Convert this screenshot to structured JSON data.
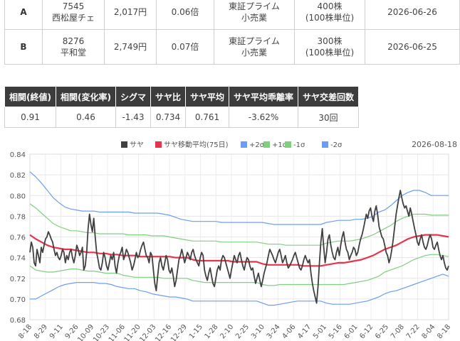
{
  "stocks": [
    {
      "label": "A",
      "code": "7545",
      "name": "西松屋チェ",
      "price": "2,017円",
      "pbr": "0.06倍",
      "market": "東証プライム",
      "sector": "小売業",
      "shares": "400株",
      "unit": "(100株単位)",
      "date": "2026-06-26"
    },
    {
      "label": "B",
      "code": "8276",
      "name": "平和堂",
      "price": "2,749円",
      "pbr": "0.07倍",
      "market": "東証プライム",
      "sector": "小売業",
      "shares": "300株",
      "unit": "(100株単位)",
      "date": "2026-06-25"
    }
  ],
  "stats": {
    "headers": [
      "相関(終値)",
      "相関(変化率)",
      "シグマ",
      "サヤ比",
      "サヤ平均",
      "サヤ平均乖離率",
      "サヤ交差回数"
    ],
    "values": [
      "0.91",
      "0.46",
      "-1.43",
      "0.734",
      "0.761",
      "-3.62%",
      "30回"
    ]
  },
  "chart_data": {
    "type": "line",
    "date_label": "2026-08-18",
    "legend": [
      {
        "name": "サヤ",
        "color": "#404040"
      },
      {
        "name": "サヤ移動平均(75日)",
        "color": "#e8334a"
      },
      {
        "name": "+2σ",
        "color": "#6b9df7"
      },
      {
        "name": "+1σ",
        "color": "#7fcf7f"
      },
      {
        "name": "-1σ",
        "color": "#7fcf7f"
      },
      {
        "name": "-2σ",
        "color": "#6b9df7"
      }
    ],
    "ylim": [
      0.68,
      0.84
    ],
    "yticks": [
      "0.84",
      "0.82",
      "0.80",
      "0.78",
      "0.76",
      "0.74",
      "0.72",
      "0.70",
      "0.68"
    ],
    "xticks": [
      "8-18",
      "8-29",
      "9-11",
      "9-26",
      "10-09",
      "10-23",
      "11-06",
      "11-20",
      "12-03",
      "12-16",
      "12-29",
      "1-15",
      "1-28",
      "2-10",
      "2-25",
      "3-10",
      "3-24",
      "4-06",
      "4-17",
      "5-01",
      "5-16",
      "6-01",
      "6-12",
      "6-25",
      "7-08",
      "7-22",
      "8-04",
      "8-18"
    ],
    "series": [
      {
        "name": "サヤ",
        "color": "#404040",
        "values": [
          0.745,
          0.755,
          0.75,
          0.735,
          0.732,
          0.748,
          0.742,
          0.735,
          0.75,
          0.745,
          0.752,
          0.758,
          0.76,
          0.765,
          0.762,
          0.758,
          0.755,
          0.748,
          0.742,
          0.745,
          0.74,
          0.738,
          0.742,
          0.748,
          0.745,
          0.735,
          0.742,
          0.738,
          0.745,
          0.748,
          0.74,
          0.735,
          0.742,
          0.752,
          0.748,
          0.742,
          0.745,
          0.75,
          0.728,
          0.732,
          0.745,
          0.768,
          0.782,
          0.772,
          0.765,
          0.778,
          0.76,
          0.745,
          0.738,
          0.73,
          0.728,
          0.735,
          0.745,
          0.74,
          0.732,
          0.728,
          0.735,
          0.742,
          0.738,
          0.745,
          0.732,
          0.725,
          0.735,
          0.742,
          0.745,
          0.75,
          0.738,
          0.742,
          0.748,
          0.745,
          0.74,
          0.735,
          0.728,
          0.732,
          0.738,
          0.745,
          0.74,
          0.742,
          0.748,
          0.752,
          0.755,
          0.748,
          0.742,
          0.74,
          0.735,
          0.745,
          0.742,
          0.728,
          0.715,
          0.708,
          0.722,
          0.735,
          0.74,
          0.732,
          0.728,
          0.735,
          0.742,
          0.738,
          0.728,
          0.725,
          0.73,
          0.722,
          0.712,
          0.718,
          0.728,
          0.738,
          0.742,
          0.748,
          0.742,
          0.735,
          0.74,
          0.745,
          0.742,
          0.738,
          0.745,
          0.748,
          0.742,
          0.738,
          0.735,
          0.732,
          0.74,
          0.745,
          0.742,
          0.728,
          0.722,
          0.718,
          0.725,
          0.73,
          0.722,
          0.715,
          0.712,
          0.72,
          0.728,
          0.732,
          0.728,
          0.738,
          0.742,
          0.74,
          0.735,
          0.73,
          0.725,
          0.72,
          0.728,
          0.735,
          0.742,
          0.738,
          0.735,
          0.742,
          0.745,
          0.738,
          0.732,
          0.728,
          0.735,
          0.74,
          0.738,
          0.732,
          0.728,
          0.73,
          0.722,
          0.715,
          0.72,
          0.725,
          0.718,
          0.712,
          0.718,
          0.725,
          0.73,
          0.735,
          0.742,
          0.748,
          0.745,
          0.742,
          0.738,
          0.735,
          0.74,
          0.745,
          0.748,
          0.742,
          0.735,
          0.738,
          0.742,
          0.735,
          0.73,
          0.732,
          0.735,
          0.738,
          0.742,
          0.745,
          0.74,
          0.735,
          0.73,
          0.728,
          0.732,
          0.738,
          0.742,
          0.738,
          0.735,
          0.738,
          0.725,
          0.715,
          0.708,
          0.702,
          0.696,
          0.712,
          0.735,
          0.755,
          0.768,
          0.75,
          0.735,
          0.745,
          0.758,
          0.762,
          0.752,
          0.745,
          0.74,
          0.738,
          0.745,
          0.75,
          0.742,
          0.752,
          0.76,
          0.765,
          0.755,
          0.748,
          0.745,
          0.738,
          0.742,
          0.745,
          0.75,
          0.748,
          0.742,
          0.745,
          0.752,
          0.758,
          0.762,
          0.768,
          0.775,
          0.782,
          0.778,
          0.785,
          0.788,
          0.78,
          0.775,
          0.785,
          0.79,
          0.782,
          0.77,
          0.765,
          0.76,
          0.758,
          0.752,
          0.745,
          0.742,
          0.735,
          0.74,
          0.748,
          0.758,
          0.77,
          0.782,
          0.79,
          0.798,
          0.805,
          0.798,
          0.792,
          0.788,
          0.79,
          0.785,
          0.78,
          0.788,
          0.782,
          0.775,
          0.768,
          0.762,
          0.755,
          0.752,
          0.758,
          0.762,
          0.755,
          0.75,
          0.748,
          0.752,
          0.758,
          0.762,
          0.758,
          0.75,
          0.748,
          0.752,
          0.755,
          0.748,
          0.742,
          0.738,
          0.742,
          0.735,
          0.73,
          0.728,
          0.732
        ]
      },
      {
        "name": "サヤ移動平均(75日)",
        "color": "#e8334a",
        "values": [
          0.762,
          0.758,
          0.755,
          0.752,
          0.75,
          0.749,
          0.748,
          0.748,
          0.747,
          0.746,
          0.745,
          0.745,
          0.744,
          0.744,
          0.743,
          0.743,
          0.742,
          0.742,
          0.742,
          0.741,
          0.741,
          0.741,
          0.741,
          0.741,
          0.741,
          0.74,
          0.74,
          0.74,
          0.738,
          0.737,
          0.737,
          0.737,
          0.737,
          0.737,
          0.737,
          0.736,
          0.736,
          0.736,
          0.736,
          0.736,
          0.734,
          0.733,
          0.733,
          0.733,
          0.733,
          0.733,
          0.733,
          0.732,
          0.732,
          0.732,
          0.732,
          0.733,
          0.734,
          0.735,
          0.735,
          0.736,
          0.737,
          0.738,
          0.74,
          0.742,
          0.745,
          0.748,
          0.75,
          0.752,
          0.755,
          0.758,
          0.76,
          0.761,
          0.762,
          0.762,
          0.762,
          0.761,
          0.76
        ]
      },
      {
        "name": "+2σ",
        "color": "#6b9df7",
        "values": [
          0.823,
          0.818,
          0.812,
          0.805,
          0.798,
          0.793,
          0.789,
          0.787,
          0.786,
          0.785,
          0.785,
          0.785,
          0.784,
          0.784,
          0.784,
          0.784,
          0.784,
          0.784,
          0.783,
          0.783,
          0.783,
          0.783,
          0.783,
          0.782,
          0.781,
          0.779,
          0.777,
          0.776,
          0.775,
          0.775,
          0.775,
          0.775,
          0.775,
          0.774,
          0.774,
          0.774,
          0.774,
          0.774,
          0.774,
          0.774,
          0.774,
          0.773,
          0.772,
          0.772,
          0.772,
          0.772,
          0.772,
          0.772,
          0.772,
          0.772,
          0.772,
          0.774,
          0.775,
          0.776,
          0.776,
          0.776,
          0.777,
          0.777,
          0.778,
          0.78,
          0.784,
          0.786,
          0.79,
          0.795,
          0.8,
          0.803,
          0.805,
          0.805,
          0.803,
          0.8,
          0.8,
          0.8,
          0.8
        ]
      },
      {
        "name": "+1σ",
        "color": "#7fcf7f",
        "values": [
          0.792,
          0.788,
          0.783,
          0.778,
          0.773,
          0.77,
          0.768,
          0.766,
          0.766,
          0.765,
          0.764,
          0.764,
          0.763,
          0.763,
          0.763,
          0.763,
          0.763,
          0.762,
          0.762,
          0.762,
          0.762,
          0.761,
          0.761,
          0.761,
          0.76,
          0.759,
          0.758,
          0.757,
          0.756,
          0.756,
          0.756,
          0.756,
          0.756,
          0.755,
          0.755,
          0.755,
          0.755,
          0.755,
          0.755,
          0.755,
          0.754,
          0.753,
          0.753,
          0.753,
          0.752,
          0.752,
          0.752,
          0.752,
          0.752,
          0.752,
          0.752,
          0.754,
          0.755,
          0.756,
          0.756,
          0.756,
          0.757,
          0.758,
          0.76,
          0.762,
          0.765,
          0.768,
          0.771,
          0.775,
          0.778,
          0.78,
          0.782,
          0.782,
          0.782,
          0.781,
          0.781,
          0.781,
          0.781
        ]
      },
      {
        "name": "-1σ",
        "color": "#7fcf7f",
        "values": [
          0.732,
          0.728,
          0.727,
          0.726,
          0.726,
          0.727,
          0.728,
          0.729,
          0.729,
          0.728,
          0.727,
          0.727,
          0.726,
          0.725,
          0.725,
          0.725,
          0.723,
          0.722,
          0.721,
          0.721,
          0.721,
          0.721,
          0.721,
          0.72,
          0.72,
          0.72,
          0.72,
          0.72,
          0.718,
          0.717,
          0.716,
          0.716,
          0.716,
          0.716,
          0.716,
          0.716,
          0.716,
          0.716,
          0.716,
          0.716,
          0.714,
          0.713,
          0.713,
          0.714,
          0.714,
          0.714,
          0.714,
          0.714,
          0.714,
          0.714,
          0.714,
          0.714,
          0.714,
          0.714,
          0.714,
          0.715,
          0.716,
          0.717,
          0.718,
          0.72,
          0.722,
          0.726,
          0.728,
          0.73,
          0.732,
          0.735,
          0.738,
          0.74,
          0.742,
          0.743,
          0.743,
          0.742,
          0.741
        ]
      },
      {
        "name": "-2σ",
        "color": "#6b9df7",
        "values": [
          0.7,
          0.7,
          0.703,
          0.706,
          0.709,
          0.712,
          0.714,
          0.715,
          0.716,
          0.716,
          0.716,
          0.716,
          0.715,
          0.715,
          0.714,
          0.712,
          0.711,
          0.71,
          0.71,
          0.708,
          0.707,
          0.705,
          0.704,
          0.703,
          0.702,
          0.702,
          0.701,
          0.7,
          0.698,
          0.698,
          0.698,
          0.698,
          0.698,
          0.698,
          0.698,
          0.698,
          0.698,
          0.698,
          0.698,
          0.698,
          0.696,
          0.694,
          0.694,
          0.695,
          0.696,
          0.697,
          0.698,
          0.698,
          0.698,
          0.698,
          0.698,
          0.696,
          0.695,
          0.695,
          0.695,
          0.695,
          0.696,
          0.697,
          0.698,
          0.7,
          0.702,
          0.705,
          0.707,
          0.708,
          0.71,
          0.712,
          0.714,
          0.716,
          0.718,
          0.72,
          0.722,
          0.724,
          0.722
        ]
      }
    ]
  }
}
